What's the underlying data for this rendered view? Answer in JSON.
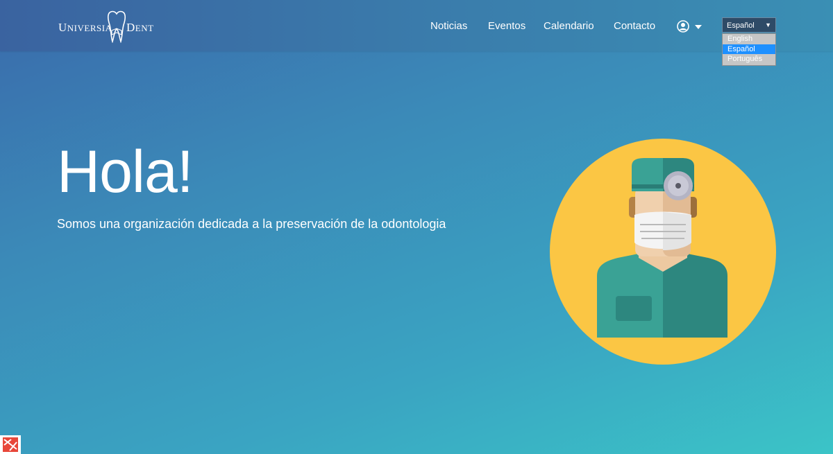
{
  "header": {
    "logo": {
      "part1": "Universia",
      "part2": "Dent"
    },
    "nav": [
      "Noticias",
      "Eventos",
      "Calendario",
      "Contacto"
    ],
    "language": {
      "selected": "Español",
      "options": [
        "English",
        "Español",
        "Português"
      ]
    }
  },
  "hero": {
    "title": "Hola!",
    "subtitle": "Somos una organización dedicada a la preservación de la odontologia"
  },
  "colors": {
    "accent_yellow": "#fbc644",
    "scrub_light": "#3aa295",
    "scrub_dark": "#2d877f",
    "selected_option": "#1e90ff"
  }
}
